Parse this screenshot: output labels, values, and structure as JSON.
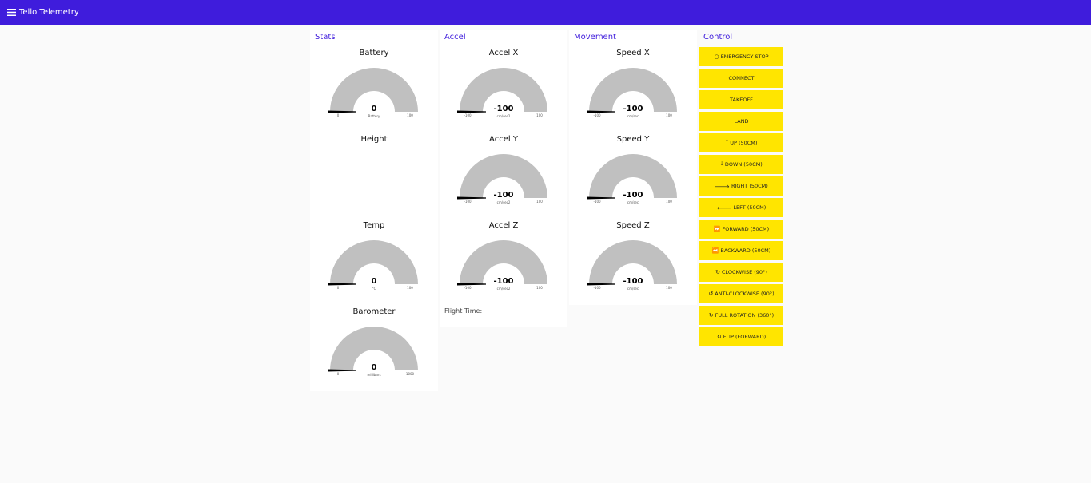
{
  "app": {
    "title": "Tello Telemetry",
    "menu_icon": "menu-icon"
  },
  "groups": {
    "stats": {
      "title": "Stats",
      "battery": {
        "label": "Battery",
        "value": "0",
        "units": "Battery",
        "min": "0",
        "max": "100"
      },
      "height": {
        "label": "Height"
      },
      "temp": {
        "label": "Temp",
        "value": "0",
        "units": "°C",
        "min": "0",
        "max": "100"
      },
      "barometer": {
        "label": "Barometer",
        "value": "0",
        "units": "millibars",
        "min": "0",
        "max": "1000"
      }
    },
    "accel": {
      "title": "Accel",
      "x": {
        "label": "Accel X",
        "value": "-100",
        "units": "cm/sec2",
        "min": "-100",
        "max": "100"
      },
      "y": {
        "label": "Accel Y",
        "value": "-100",
        "units": "cm/sec2",
        "min": "-100",
        "max": "100"
      },
      "z": {
        "label": "Accel Z",
        "value": "-100",
        "units": "cm/sec2",
        "min": "-100",
        "max": "100"
      },
      "flight_time": "Flight Time:"
    },
    "movement": {
      "title": "Movement",
      "x": {
        "label": "Speed X",
        "value": "-100",
        "units": "cm/sec",
        "min": "-100",
        "max": "100"
      },
      "y": {
        "label": "Speed Y",
        "value": "-100",
        "units": "cm/sec",
        "min": "-100",
        "max": "100"
      },
      "z": {
        "label": "Speed Z",
        "value": "-100",
        "units": "cm/sec",
        "min": "-100",
        "max": "100"
      }
    },
    "control": {
      "title": "Control",
      "buttons": [
        {
          "label": "EMERGENCY STOP",
          "icon": "○"
        },
        {
          "label": "CONNECT",
          "icon": ""
        },
        {
          "label": "TAKEOFF",
          "icon": ""
        },
        {
          "label": "LAND",
          "icon": ""
        },
        {
          "label": "UP (50CM)",
          "icon": "🡑"
        },
        {
          "label": "DOWN (50CM)",
          "icon": "🡓"
        },
        {
          "label": "RIGHT (50CM)",
          "icon": "🡒"
        },
        {
          "label": "LEFT (50CM)",
          "icon": "🡐"
        },
        {
          "label": "FORWARD (50CM)",
          "icon": "⏩"
        },
        {
          "label": "BACKWARD (50CM)",
          "icon": "⏪"
        },
        {
          "label": "CLOCKWISE (90°)",
          "icon": "↻"
        },
        {
          "label": "ANTI-CLOCKWISE (90°)",
          "icon": "↺"
        },
        {
          "label": "FULL ROTATION (360°)",
          "icon": "↻"
        },
        {
          "label": "FLIP (FORWARD)",
          "icon": "↻"
        }
      ]
    }
  },
  "colors": {
    "header": "#3f1cdc",
    "gauge_track": "#c0c0c0",
    "button": "#ffe500",
    "needle": "#000000"
  }
}
